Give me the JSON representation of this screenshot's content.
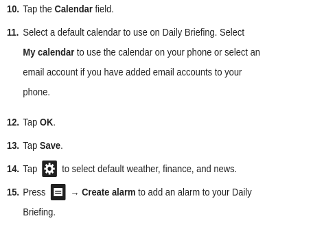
{
  "steps": [
    {
      "num": "10.",
      "pre": "Tap the ",
      "b1": "Calendar",
      "post": " field."
    },
    {
      "num": "11.",
      "line1": "Select a default calendar to use on Daily Briefing. Select",
      "b1": "My calendar",
      "line2rest": " to use the calendar on your phone or select an",
      "line3": "email account if you have added email accounts to your",
      "line4": "phone."
    },
    {
      "num": "12.",
      "pre": "Tap ",
      "b1": "OK",
      "post": "."
    },
    {
      "num": "13.",
      "pre": "Tap ",
      "b1": "Save",
      "post": "."
    },
    {
      "num": "14.",
      "pre": "Tap",
      "icon": "gear-icon",
      "post": "to select default weather, finance, and news."
    },
    {
      "num": "15.",
      "pre": "Press",
      "icon": "menu-icon",
      "arrow": "→",
      "b1": "Create alarm",
      "post": " to add an alarm to your Daily",
      "line2": "Briefing."
    }
  ]
}
